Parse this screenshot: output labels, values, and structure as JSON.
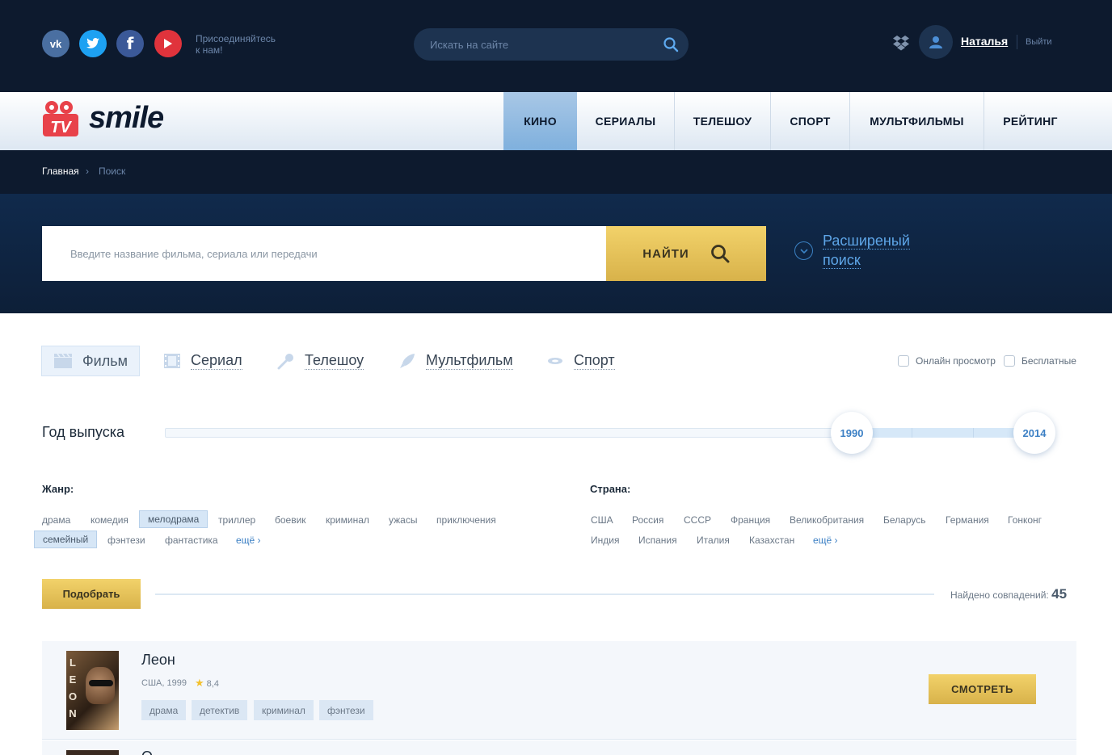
{
  "header": {
    "socials": [
      {
        "icon": "vk-icon",
        "glyph": "vk"
      },
      {
        "icon": "twitter-icon",
        "glyph": "🐦"
      },
      {
        "icon": "facebook-icon",
        "glyph": "f"
      },
      {
        "icon": "youtube-icon",
        "glyph": "▶"
      }
    ],
    "join_line1": "Присоединяйтесь",
    "join_line2": "к нам!",
    "search_placeholder": "Искать на сайте",
    "user_name": "Наталья",
    "logout": "Выйти"
  },
  "brand": {
    "logo_text": "smile",
    "logo_icon": "camera-tv-icon",
    "accent": "#e8424a"
  },
  "nav": [
    {
      "label": "КИНО",
      "active": true
    },
    {
      "label": "СЕРИАЛЫ",
      "active": false
    },
    {
      "label": "ТЕЛЕШОУ",
      "active": false
    },
    {
      "label": "СПОРТ",
      "active": false
    },
    {
      "label": "МУЛЬТФИЛЬМЫ",
      "active": false
    },
    {
      "label": "РЕЙТИНГ",
      "active": false
    }
  ],
  "breadcrumb": {
    "home": "Главная",
    "sep": "›",
    "current": "Поиск"
  },
  "search": {
    "placeholder": "Введите название фильма, сериала или передачи",
    "button": "НАЙТИ",
    "advanced_line1": "Расширеный",
    "advanced_line2": "поиск"
  },
  "types": [
    {
      "label": "Фильм",
      "icon": "clapper-icon",
      "active": true
    },
    {
      "label": "Сериал",
      "icon": "film-strip-icon",
      "active": false
    },
    {
      "label": "Телешоу",
      "icon": "microphone-icon",
      "active": false
    },
    {
      "label": "Мультфильм",
      "icon": "rocket-icon",
      "active": false
    },
    {
      "label": "Спорт",
      "icon": "sport-icon",
      "active": false
    }
  ],
  "checkboxes": {
    "online": "Онлайн просмотр",
    "free": "Бесплатные"
  },
  "year": {
    "label": "Год выпуска",
    "from": "1990",
    "to": "2014"
  },
  "genre": {
    "title": "Жанр:",
    "row1": [
      "драма",
      "комедия",
      "мелодрама",
      "триллер",
      "боевик",
      "криминал",
      "ужасы",
      "приключения"
    ],
    "row2": [
      "семейный",
      "фэнтези",
      "фантастика"
    ],
    "selected": [
      "мелодрама",
      "семейный"
    ],
    "more": "ещё ›"
  },
  "country": {
    "title": "Страна:",
    "row1": [
      "США",
      "Россия",
      "СССР",
      "Франция",
      "Великобритания",
      "Беларусь",
      "Германия",
      "Гонконг"
    ],
    "row2": [
      "Индия",
      "Испания",
      "Италия",
      "Казахстан"
    ],
    "more": "ещё ›"
  },
  "results": {
    "pick_button": "Подобрать",
    "found_label": "Найдено совпадений:",
    "found_count": "45"
  },
  "movie": {
    "title": "Леон",
    "country_year": "США, 1999",
    "rating": "8,4",
    "poster_letters": [
      "L",
      "E",
      "O",
      "N"
    ],
    "tags": [
      "драма",
      "детектив",
      "криминал",
      "фэнтези"
    ],
    "watch_button": "СМОТРЕТЬ"
  },
  "movie2": {
    "title_fragment": "О"
  }
}
